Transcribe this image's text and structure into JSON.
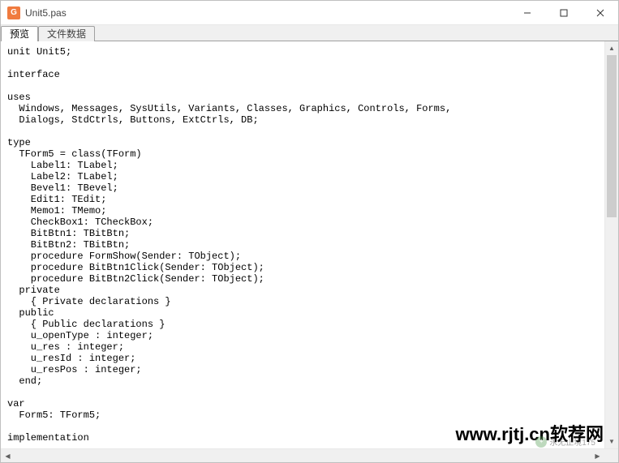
{
  "window": {
    "title": "Unit5.pas",
    "icon_label": "G"
  },
  "tabs": {
    "items": [
      {
        "label": "预览",
        "active": true
      },
      {
        "label": "文件数据",
        "active": false
      }
    ]
  },
  "code": "unit Unit5;\n\ninterface\n\nuses\n  Windows, Messages, SysUtils, Variants, Classes, Graphics, Controls, Forms,\n  Dialogs, StdCtrls, Buttons, ExtCtrls, DB;\n\ntype\n  TForm5 = class(TForm)\n    Label1: TLabel;\n    Label2: TLabel;\n    Bevel1: TBevel;\n    Edit1: TEdit;\n    Memo1: TMemo;\n    CheckBox1: TCheckBox;\n    BitBtn1: TBitBtn;\n    BitBtn2: TBitBtn;\n    procedure FormShow(Sender: TObject);\n    procedure BitBtn1Click(Sender: TObject);\n    procedure BitBtn2Click(Sender: TObject);\n  private\n    { Private declarations }\n  public\n    { Public declarations }\n    u_openType : integer;\n    u_res : integer;\n    u_resId : integer;\n    u_resPos : integer;\n  end;\n\nvar\n  Form5: TForm5;\n\nimplementation\n\nuses DmUnit;\n\n{$R *.dfm}",
  "watermark": {
    "main": "www.rjtj.cn软荐网",
    "sub": "永无止境175"
  }
}
